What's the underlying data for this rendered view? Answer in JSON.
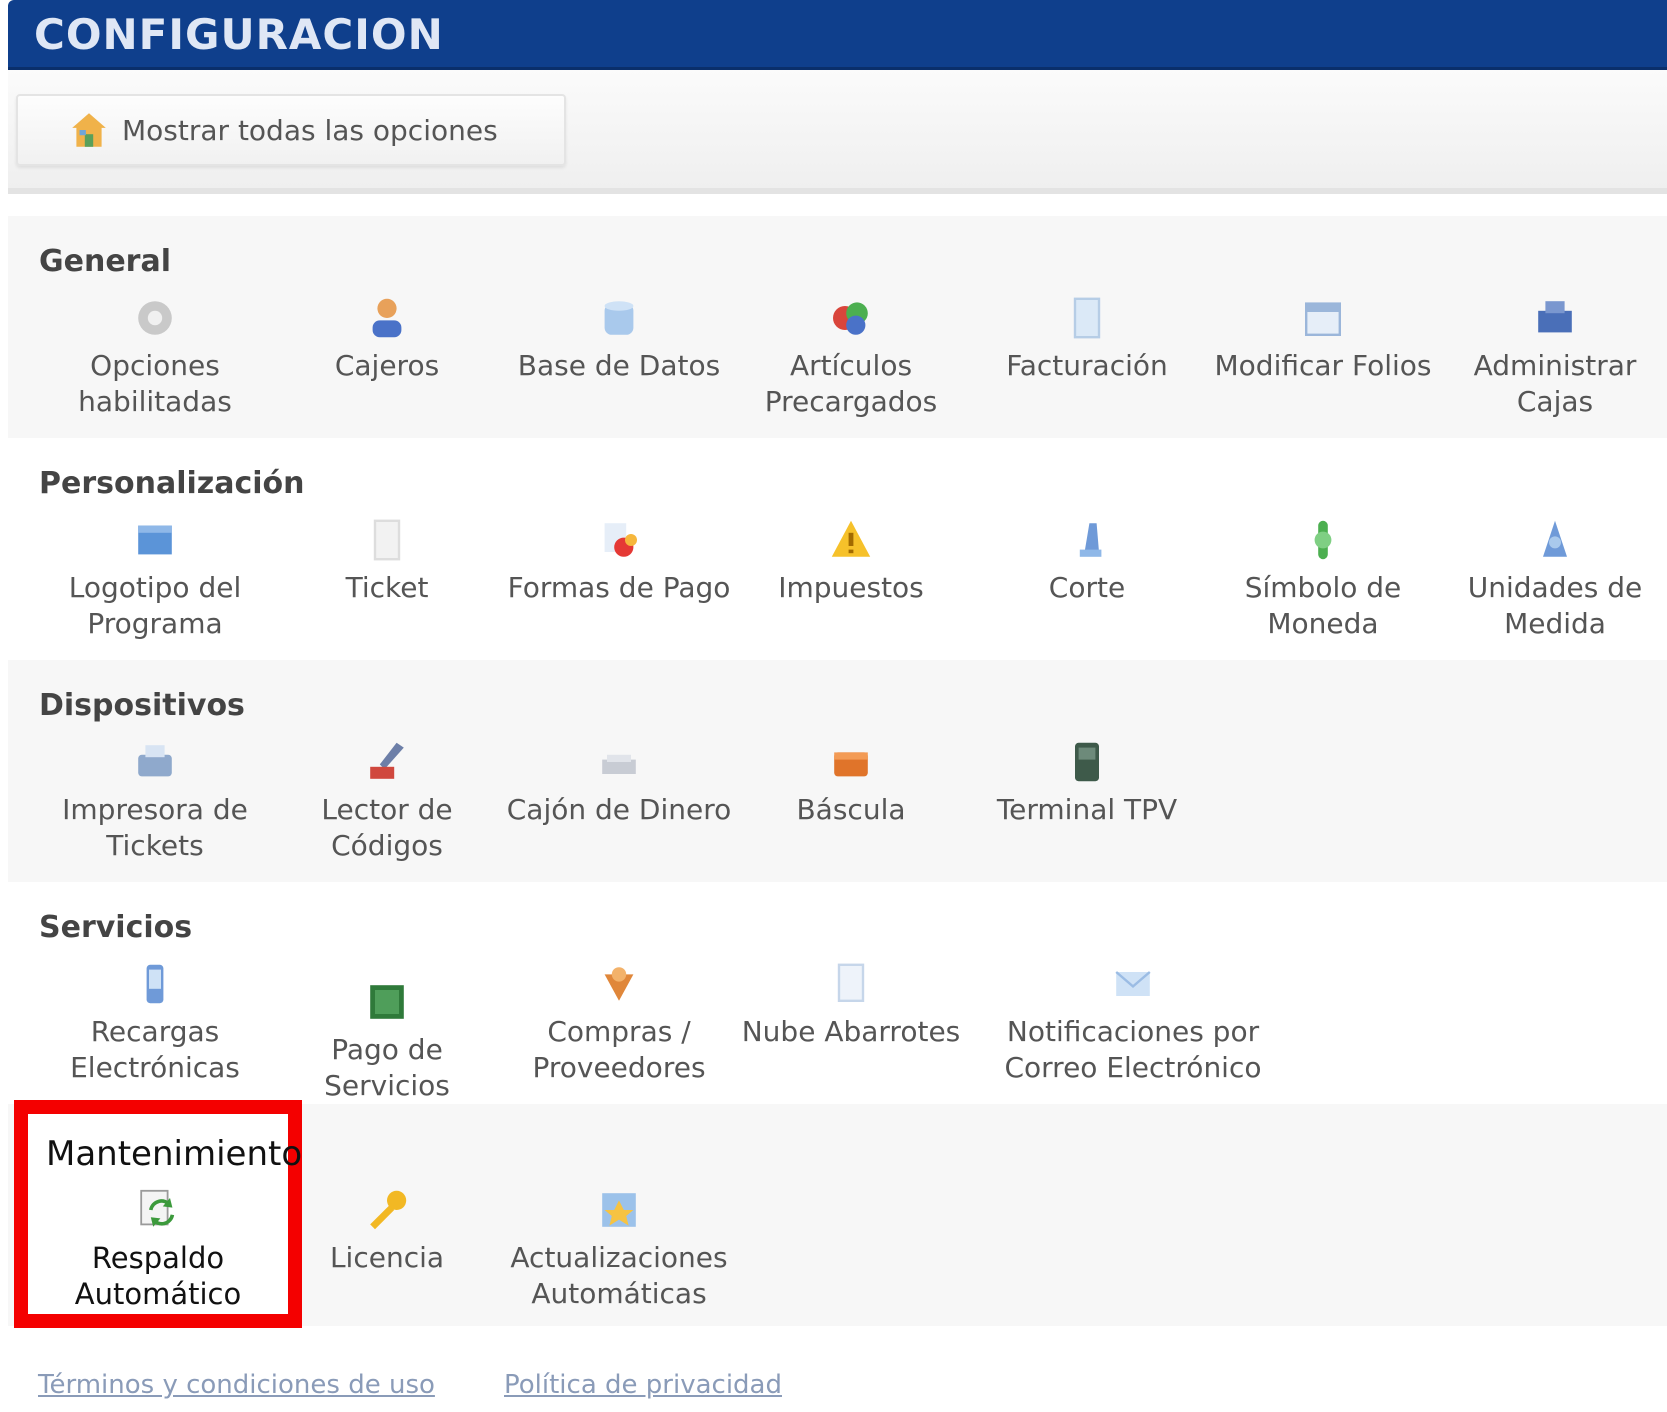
{
  "window": {
    "title": "CONFIGURACION"
  },
  "toolbar": {
    "show_all_label": "Mostrar todas las opciones"
  },
  "sections": [
    {
      "title": "General",
      "items": [
        {
          "label": "Opciones habilitadas",
          "icon": "gear-icon"
        },
        {
          "label": "Cajeros",
          "icon": "user-icon"
        },
        {
          "label": "Base de Datos",
          "icon": "database-icon"
        },
        {
          "label": "Artículos Precargados",
          "icon": "products-icon"
        },
        {
          "label": "Facturación",
          "icon": "invoice-icon"
        },
        {
          "label": "Modificar Folios",
          "icon": "calendar-icon"
        },
        {
          "label": "Administrar Cajas",
          "icon": "register-icon"
        }
      ]
    },
    {
      "title": "Personalización",
      "items": [
        {
          "label": "Logotipo del Programa",
          "icon": "logo-icon"
        },
        {
          "label": "Ticket",
          "icon": "ticket-icon"
        },
        {
          "label": "Formas de Pago",
          "icon": "payment-icon"
        },
        {
          "label": "Impuestos",
          "icon": "warning-icon"
        },
        {
          "label": "Corte",
          "icon": "cut-icon"
        },
        {
          "label": "Símbolo de Moneda",
          "icon": "dollar-icon"
        },
        {
          "label": "Unidades de Medida",
          "icon": "measure-icon"
        }
      ]
    },
    {
      "title": "Dispositivos",
      "items": [
        {
          "label": "Impresora de Tickets",
          "icon": "printer-icon"
        },
        {
          "label": "Lector de Códigos",
          "icon": "barcode-reader-icon"
        },
        {
          "label": "Cajón de Dinero",
          "icon": "cash-drawer-icon"
        },
        {
          "label": "Báscula",
          "icon": "scale-icon"
        },
        {
          "label": "Terminal TPV",
          "icon": "terminal-icon"
        }
      ]
    },
    {
      "title": "Servicios",
      "items": [
        {
          "label": "Recargas Electrónicas",
          "icon": "phone-icon"
        },
        {
          "label": "Pago de Servicios",
          "icon": "bill-icon"
        },
        {
          "label": "Compras / Proveedores",
          "icon": "shopping-icon"
        },
        {
          "label": "Nube Abarrotes",
          "icon": "cloud-doc-icon"
        },
        {
          "label": "Notificaciones por Correo Electrónico",
          "icon": "email-icon"
        }
      ]
    },
    {
      "title": "Mantenimiento",
      "items": [
        {
          "label": "Respaldo Automático",
          "icon": "backup-icon"
        },
        {
          "label": "Licencia",
          "icon": "key-icon"
        },
        {
          "label": "Actualizaciones Automáticas",
          "icon": "update-icon"
        }
      ]
    }
  ],
  "footer": {
    "terms_label": "Términos y condiciones de uso",
    "privacy_label": "Política de privacidad"
  }
}
